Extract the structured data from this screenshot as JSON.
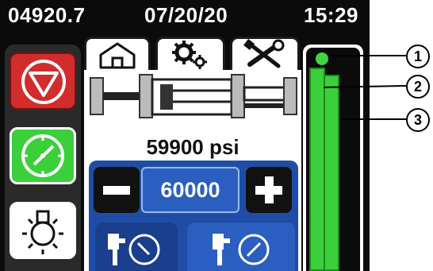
{
  "status_bar": {
    "counter": "04920.7",
    "date": "07/20/20",
    "time": "15:29"
  },
  "tabs": [
    {
      "icon": "home-icon"
    },
    {
      "icon": "gears-icon"
    },
    {
      "icon": "wrench-screwdriver-icon"
    }
  ],
  "left_buttons": [
    {
      "icon": "stop-icon",
      "color": "#d12d2d"
    },
    {
      "icon": "gauge-icon",
      "color": "#3ccf3c"
    },
    {
      "icon": "light-bulb-icon",
      "color": "#ffffff"
    }
  ],
  "main": {
    "pressure_reading": "59900 psi",
    "setpoint": "60000",
    "decrease_icon": "minus-icon",
    "increase_icon": "plus-icon",
    "modes": [
      {
        "icon": "tool-gauge-icon"
      },
      {
        "icon": "tool-gauge-icon"
      }
    ]
  },
  "right_panel": {
    "indicator_color": "#3fd63f",
    "bars": [
      {
        "level": 0.91
      },
      {
        "level": 0.88
      }
    ]
  },
  "callouts": [
    "1",
    "2",
    "3"
  ],
  "colors": {
    "accent_blue": "#1f4da6",
    "green": "#3ccf3c",
    "red": "#d12d2d"
  }
}
